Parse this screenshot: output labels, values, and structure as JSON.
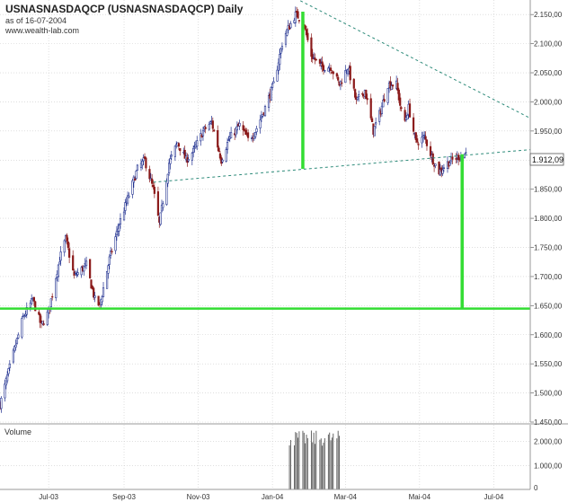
{
  "header": {
    "title": "USNASNASDAQCP (USNASNASDAQCP) Daily",
    "asof": "as of 16-07-2004",
    "site": "www.wealth-lab.com"
  },
  "volume_panel": {
    "label": "Volume"
  },
  "colors": {
    "up": "#1f2f8f",
    "down": "#8b1a1a",
    "trendline": "#2e8b7a",
    "target": "#33dd33",
    "grid": "#cccccc",
    "axis_text": "#333333",
    "volume": "#555555",
    "price_box_bg": "#ffffff"
  },
  "chart_data": {
    "type": "candlestick",
    "title": "USNASNASDAQCP (USNASNASDAQCP) Daily",
    "y_label": "",
    "ylim": [
      1450,
      2175
    ],
    "y_ticks": [
      "2.150,00",
      "2.100,00",
      "2.050,00",
      "2.000,00",
      "1.950,00",
      "1.900,00",
      "1.850,00",
      "1.800,00",
      "1.750,00",
      "1.700,00",
      "1.650,00",
      "1.600,00",
      "1.550,00",
      "1.500,00",
      "1.450,00"
    ],
    "y_tick_values": [
      2150,
      2100,
      2050,
      2000,
      1950,
      1900,
      1850,
      1800,
      1750,
      1700,
      1650,
      1600,
      1550,
      1500,
      1450
    ],
    "x_ticks": [
      "Jul-03",
      "Sep-03",
      "Nov-03",
      "Jan-04",
      "Mar-04",
      "Mai-04",
      "Jul-04"
    ],
    "x_tick_dates": [
      "2003-07-01",
      "2003-09-01",
      "2003-11-01",
      "2004-01-01",
      "2004-03-01",
      "2004-05-01",
      "2004-07-01"
    ],
    "x_range": [
      "2003-05-22",
      "2004-07-31"
    ],
    "last_price_label": "1.912,09",
    "last_price": 1912.09,
    "anchors": [
      [
        "2003-05-22",
        1480
      ],
      [
        "2003-06-01",
        1560
      ],
      [
        "2003-06-10",
        1630
      ],
      [
        "2003-06-18",
        1660
      ],
      [
        "2003-06-25",
        1615
      ],
      [
        "2003-07-01",
        1640
      ],
      [
        "2003-07-10",
        1730
      ],
      [
        "2003-07-15",
        1765
      ],
      [
        "2003-07-22",
        1700
      ],
      [
        "2003-08-01",
        1720
      ],
      [
        "2003-08-08",
        1660
      ],
      [
        "2003-08-12",
        1650
      ],
      [
        "2003-08-20",
        1730
      ],
      [
        "2003-08-28",
        1790
      ],
      [
        "2003-09-05",
        1840
      ],
      [
        "2003-09-12",
        1885
      ],
      [
        "2003-09-18",
        1900
      ],
      [
        "2003-09-25",
        1850
      ],
      [
        "2003-09-30",
        1790
      ],
      [
        "2003-10-08",
        1895
      ],
      [
        "2003-10-15",
        1930
      ],
      [
        "2003-10-22",
        1900
      ],
      [
        "2003-10-28",
        1915
      ],
      [
        "2003-11-05",
        1950
      ],
      [
        "2003-11-12",
        1965
      ],
      [
        "2003-11-20",
        1900
      ],
      [
        "2003-11-26",
        1935
      ],
      [
        "2003-12-05",
        1960
      ],
      [
        "2003-12-12",
        1935
      ],
      [
        "2003-12-18",
        1950
      ],
      [
        "2003-12-26",
        1990
      ],
      [
        "2004-01-02",
        2030
      ],
      [
        "2004-01-10",
        2110
      ],
      [
        "2004-01-20",
        2150
      ],
      [
        "2004-01-26",
        2140
      ],
      [
        "2004-02-02",
        2080
      ],
      [
        "2004-02-10",
        2060
      ],
      [
        "2004-02-18",
        2060
      ],
      [
        "2004-02-25",
        2030
      ],
      [
        "2004-03-03",
        2060
      ],
      [
        "2004-03-10",
        2000
      ],
      [
        "2004-03-17",
        2020
      ],
      [
        "2004-03-24",
        1950
      ],
      [
        "2004-03-30",
        1985
      ],
      [
        "2004-04-05",
        2030
      ],
      [
        "2004-04-12",
        2030
      ],
      [
        "2004-04-18",
        1960
      ],
      [
        "2004-04-22",
        1990
      ],
      [
        "2004-04-28",
        1930
      ],
      [
        "2004-05-05",
        1940
      ],
      [
        "2004-05-12",
        1900
      ],
      [
        "2004-05-17",
        1880
      ],
      [
        "2004-05-24",
        1895
      ],
      [
        "2004-06-01",
        1905
      ],
      [
        "2004-06-08",
        1912
      ]
    ],
    "volume_axis_ticks": [
      "2.000,00",
      "1.000,00"
    ],
    "volume_axis_values": [
      2000,
      1000
    ],
    "volume_range": [
      "2004-01-15",
      "2004-02-25"
    ],
    "volume_level_approx": 2200,
    "volume_ylim": [
      0,
      2700
    ],
    "annotations": [
      {
        "kind": "dotted-trendline",
        "from": [
          "2004-01-20",
          2178
        ],
        "to": [
          "2004-07-31",
          1972
        ]
      },
      {
        "kind": "dotted-trendline",
        "from": [
          "2003-09-25",
          1862
        ],
        "to": [
          "2004-07-31",
          1918
        ]
      },
      {
        "kind": "vertical-measure",
        "at": "2004-01-26",
        "from": 1885,
        "to": 2155
      },
      {
        "kind": "vertical-measure",
        "at": "2004-06-05",
        "from": 1645,
        "to": 1910
      },
      {
        "kind": "horizontal-level",
        "value": 1645
      }
    ]
  }
}
